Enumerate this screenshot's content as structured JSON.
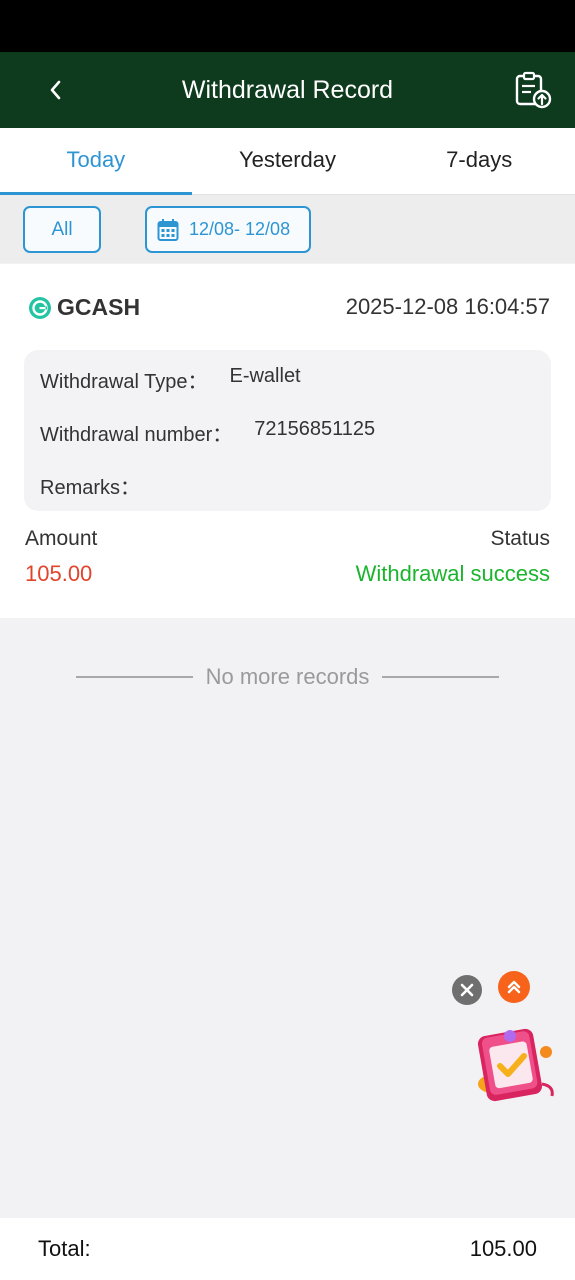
{
  "header": {
    "title": "Withdrawal Record"
  },
  "tabs": [
    {
      "label": "Today",
      "active": true
    },
    {
      "label": "Yesterday",
      "active": false
    },
    {
      "label": "7-days",
      "active": false
    }
  ],
  "filter": {
    "all_label": "All",
    "date_range": "12/08- 12/08"
  },
  "record": {
    "channel": "GCASH",
    "datetime": "2025-12-08 16:04:57",
    "type_label": "Withdrawal Type：",
    "type_value": "E-wallet",
    "number_label": "Withdrawal number：",
    "number_value": "72156851125",
    "remarks_label": "Remarks：",
    "remarks_value": "",
    "amount_label": "Amount",
    "amount_value": "105.00",
    "status_label": "Status",
    "status_value": "Withdrawal success"
  },
  "list_end_text": "No more records",
  "footer": {
    "total_label": "Total:",
    "total_value": "105.00"
  },
  "colors": {
    "header_bg": "#0e3a1e",
    "accent": "#2e95d3",
    "amount": "#e0452c",
    "success": "#1bb52d",
    "float_top": "#f7631b"
  },
  "icons": {
    "back": "chevron-left-icon",
    "record": "clipboard-upload-icon",
    "calendar": "calendar-icon",
    "channel": "gcash-logo-icon",
    "close": "close-icon",
    "scroll_top": "double-chevron-up-icon",
    "gift": "gift-reward-icon"
  }
}
